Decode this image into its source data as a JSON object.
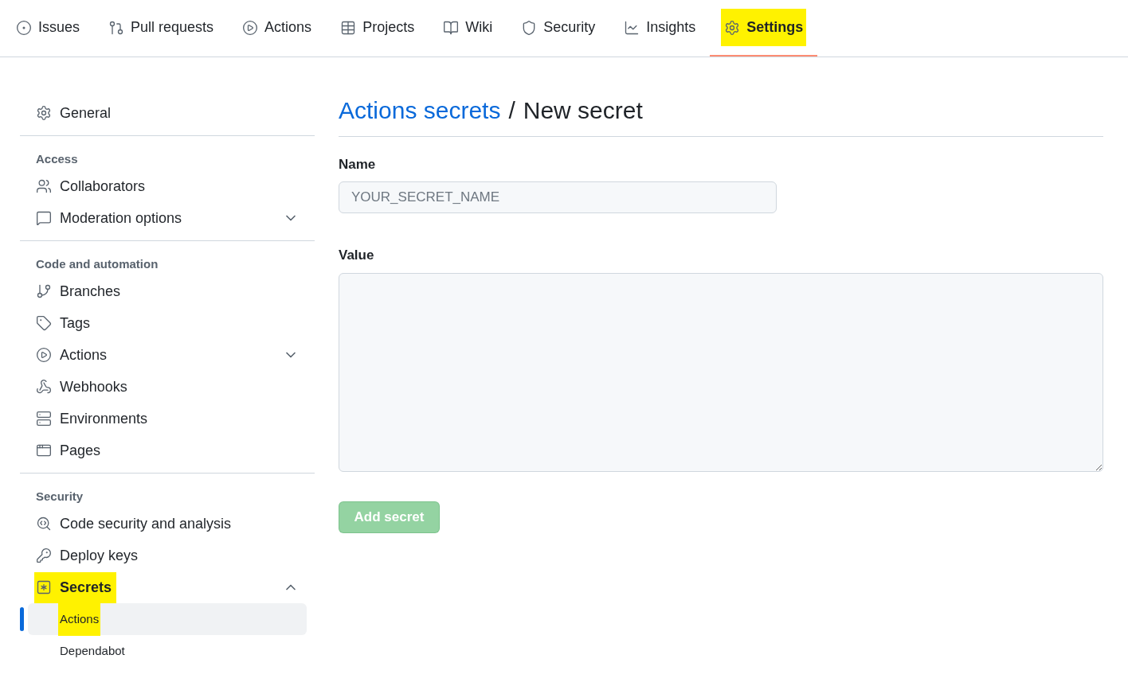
{
  "nav": {
    "tabs": [
      {
        "label": "Issues",
        "selected": false,
        "highlighted": false
      },
      {
        "label": "Pull requests",
        "selected": false,
        "highlighted": false
      },
      {
        "label": "Actions",
        "selected": false,
        "highlighted": false
      },
      {
        "label": "Projects",
        "selected": false,
        "highlighted": false
      },
      {
        "label": "Wiki",
        "selected": false,
        "highlighted": false
      },
      {
        "label": "Security",
        "selected": false,
        "highlighted": false
      },
      {
        "label": "Insights",
        "selected": false,
        "highlighted": false
      },
      {
        "label": "Settings",
        "selected": true,
        "highlighted": true
      }
    ]
  },
  "sidebar": {
    "groups": [
      {
        "items": [
          {
            "label": "General",
            "highlighted": false
          }
        ]
      },
      {
        "heading": "Access",
        "items": [
          {
            "label": "Collaborators",
            "highlighted": false
          },
          {
            "label": "Moderation options",
            "expanded": false,
            "highlighted": false
          }
        ]
      },
      {
        "heading": "Code and automation",
        "items": [
          {
            "label": "Branches",
            "highlighted": false
          },
          {
            "label": "Tags",
            "highlighted": false
          },
          {
            "label": "Actions",
            "expanded": false,
            "highlighted": false
          },
          {
            "label": "Webhooks",
            "highlighted": false
          },
          {
            "label": "Environments",
            "highlighted": false
          },
          {
            "label": "Pages",
            "highlighted": false
          }
        ]
      },
      {
        "heading": "Security",
        "items": [
          {
            "label": "Code security and analysis",
            "highlighted": false
          },
          {
            "label": "Deploy keys",
            "highlighted": false
          },
          {
            "label": "Secrets",
            "expanded": true,
            "highlighted": true,
            "children": [
              {
                "label": "Actions",
                "selected": true,
                "highlighted": true
              },
              {
                "label": "Dependabot",
                "selected": false,
                "highlighted": false
              }
            ]
          }
        ]
      }
    ]
  },
  "main": {
    "breadcrumb_link": "Actions secrets",
    "separator": "/",
    "title": "New secret",
    "name_label": "Name",
    "name_placeholder": "YOUR_SECRET_NAME",
    "value_label": "Value",
    "submit": {
      "label": "Add secret",
      "disabled": true
    }
  }
}
